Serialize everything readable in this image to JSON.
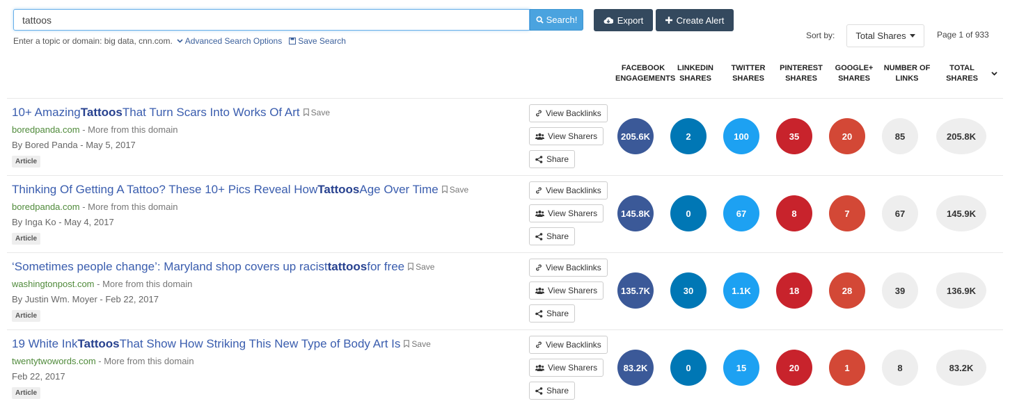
{
  "search": {
    "value": "tattoos",
    "button_label": "Search!"
  },
  "toolbar": {
    "export_label": "Export",
    "alert_label": "Create Alert"
  },
  "hint": {
    "text": "Enter a topic or domain: big data, cnn.com.",
    "advanced_label": "Advanced Search Options",
    "save_search_label": "Save Search"
  },
  "sort": {
    "label": "Sort by:",
    "selected": "Total Shares"
  },
  "pagination": {
    "text": "Page 1 of 933"
  },
  "columns": [
    {
      "line1": "FACEBOOK",
      "line2": "ENGAGEMENTS"
    },
    {
      "line1": "LINKEDIN",
      "line2": "SHARES"
    },
    {
      "line1": "TWITTER",
      "line2": "SHARES"
    },
    {
      "line1": "PINTEREST",
      "line2": "SHARES"
    },
    {
      "line1": "GOOGLE+",
      "line2": "SHARES"
    },
    {
      "line1": "NUMBER OF",
      "line2": "LINKS"
    },
    {
      "line1": "TOTAL SHARES",
      "line2": ""
    }
  ],
  "actions": {
    "backlinks": "View Backlinks",
    "sharers": "View Sharers",
    "share": "Share",
    "save": "Save",
    "more_from": "- More from this domain"
  },
  "results": [
    {
      "title_pre": "10+ Amazing ",
      "title_kw": "Tattoos",
      "title_post": " That Turn Scars Into Works Of Art",
      "domain": "boredpanda.com",
      "byline": "By Bored Panda - May 5, 2017",
      "type": "Article",
      "facebook": "205.6K",
      "linkedin": "2",
      "twitter": "100",
      "pinterest": "35",
      "google": "20",
      "links": "85",
      "total": "205.8K"
    },
    {
      "title_pre": "Thinking Of Getting A Tattoo? These 10+ Pics Reveal How ",
      "title_kw": "Tattoos",
      "title_post": " Age Over Time",
      "domain": "boredpanda.com",
      "byline": "By Inga Ko - May 4, 2017",
      "type": "Article",
      "facebook": "145.8K",
      "linkedin": "0",
      "twitter": "67",
      "pinterest": "8",
      "google": "7",
      "links": "67",
      "total": "145.9K"
    },
    {
      "title_pre": "‘Sometimes people change’: Maryland shop covers up racist ",
      "title_kw": "tattoos",
      "title_post": " for free",
      "domain": "washingtonpost.com",
      "byline": "By Justin Wm. Moyer - Feb 22, 2017",
      "type": "Article",
      "facebook": "135.7K",
      "linkedin": "30",
      "twitter": "1.1K",
      "pinterest": "18",
      "google": "28",
      "links": "39",
      "total": "136.9K"
    },
    {
      "title_pre": "19 White Ink ",
      "title_kw": "Tattoos",
      "title_post": " That Show How Striking This New Type of Body Art Is",
      "domain": "twentytwowords.com",
      "byline": "Feb 22, 2017",
      "type": "Article",
      "facebook": "83.2K",
      "linkedin": "0",
      "twitter": "15",
      "pinterest": "20",
      "google": "1",
      "links": "8",
      "total": "83.2K"
    }
  ]
}
